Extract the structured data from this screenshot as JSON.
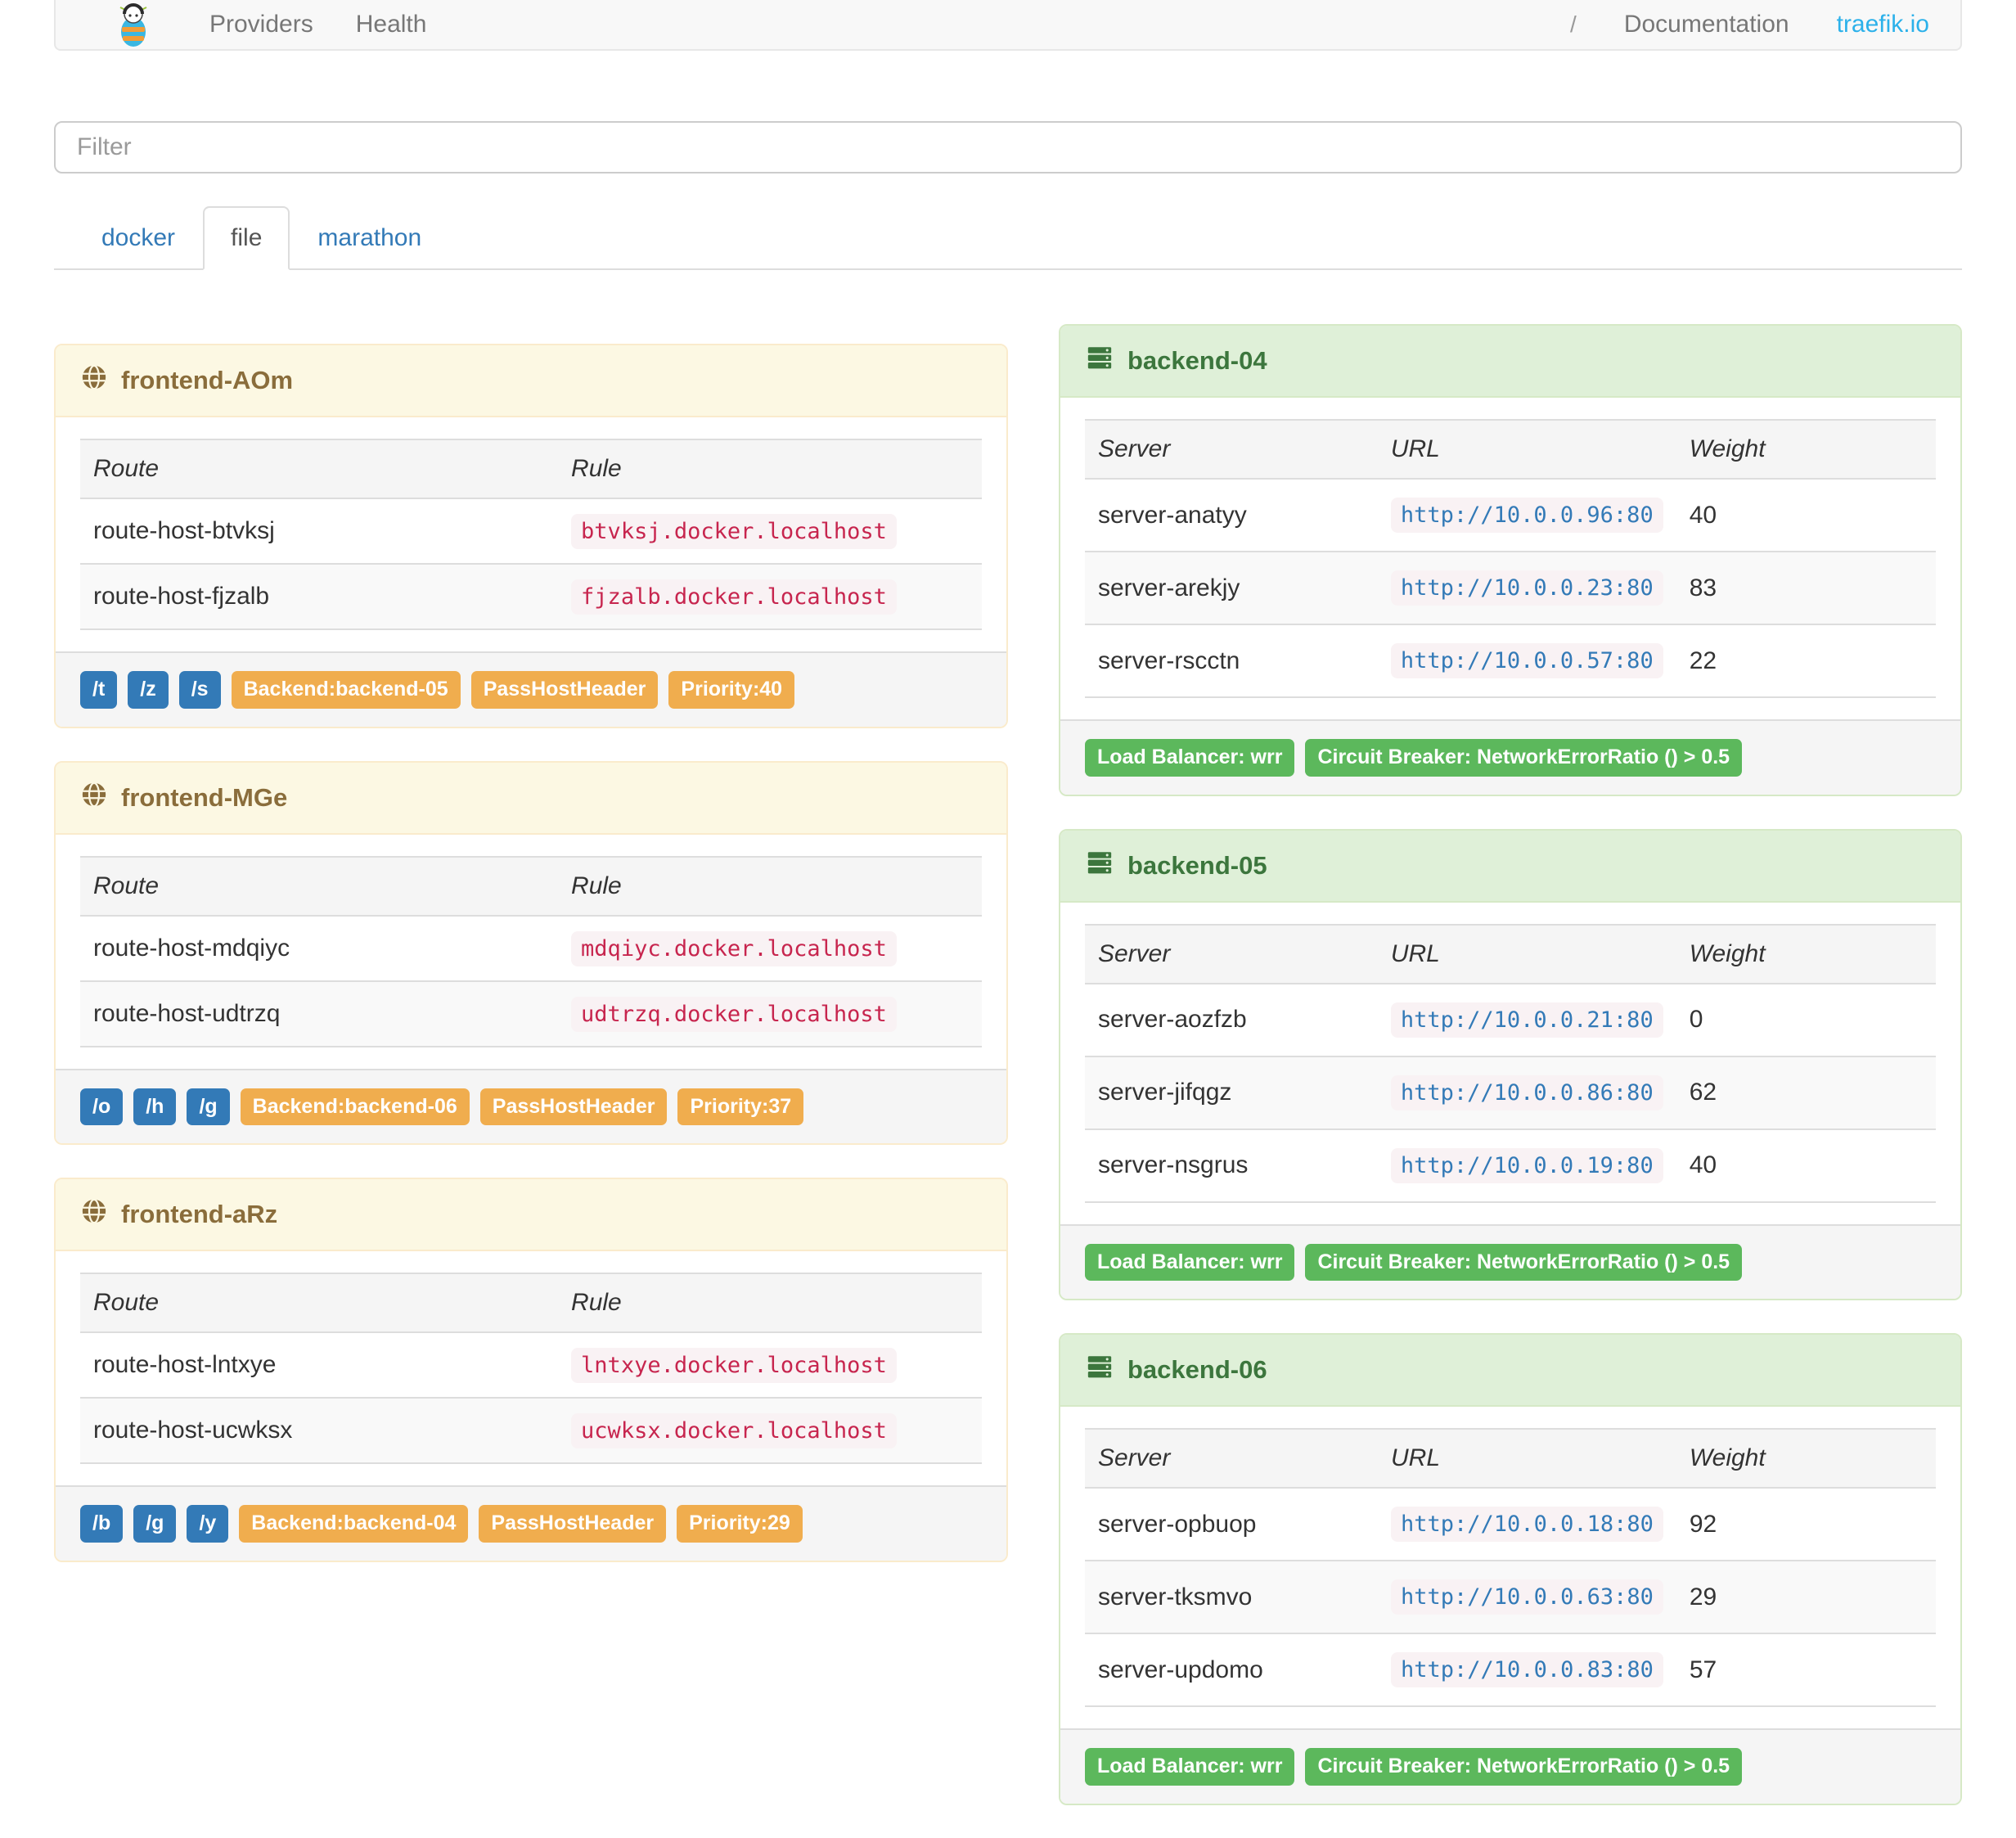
{
  "navbar": {
    "links": [
      {
        "label": "Providers"
      },
      {
        "label": "Health"
      }
    ],
    "right": {
      "divider": "/",
      "documentation": "Documentation",
      "site": "traefik.io"
    }
  },
  "filter": {
    "placeholder": "Filter"
  },
  "tabs": [
    {
      "label": "docker",
      "active": false
    },
    {
      "label": "file",
      "active": true
    },
    {
      "label": "marathon",
      "active": false
    }
  ],
  "frontends": [
    {
      "title": "frontend-AOm",
      "columns": [
        "Route",
        "Rule"
      ],
      "routes": [
        {
          "route": "route-host-btvksj",
          "rule": "btvksj.docker.localhost"
        },
        {
          "route": "route-host-fjzalb",
          "rule": "fjzalb.docker.localhost"
        }
      ],
      "path_badges": [
        "/t",
        "/z",
        "/s"
      ],
      "badges": [
        "Backend:backend-05",
        "PassHostHeader",
        "Priority:40"
      ]
    },
    {
      "title": "frontend-MGe",
      "columns": [
        "Route",
        "Rule"
      ],
      "routes": [
        {
          "route": "route-host-mdqiyc",
          "rule": "mdqiyc.docker.localhost"
        },
        {
          "route": "route-host-udtrzq",
          "rule": "udtrzq.docker.localhost"
        }
      ],
      "path_badges": [
        "/o",
        "/h",
        "/g"
      ],
      "badges": [
        "Backend:backend-06",
        "PassHostHeader",
        "Priority:37"
      ]
    },
    {
      "title": "frontend-aRz",
      "columns": [
        "Route",
        "Rule"
      ],
      "routes": [
        {
          "route": "route-host-lntxye",
          "rule": "lntxye.docker.localhost"
        },
        {
          "route": "route-host-ucwksx",
          "rule": "ucwksx.docker.localhost"
        }
      ],
      "path_badges": [
        "/b",
        "/g",
        "/y"
      ],
      "badges": [
        "Backend:backend-04",
        "PassHostHeader",
        "Priority:29"
      ]
    }
  ],
  "backends": [
    {
      "title": "backend-04",
      "columns": [
        "Server",
        "URL",
        "Weight"
      ],
      "servers": [
        {
          "name": "server-anatyy",
          "url": "http://10.0.0.96:80",
          "weight": "40"
        },
        {
          "name": "server-arekjy",
          "url": "http://10.0.0.23:80",
          "weight": "83"
        },
        {
          "name": "server-rscctn",
          "url": "http://10.0.0.57:80",
          "weight": "22"
        }
      ],
      "badges": [
        "Load Balancer: wrr",
        "Circuit Breaker: NetworkErrorRatio () > 0.5"
      ]
    },
    {
      "title": "backend-05",
      "columns": [
        "Server",
        "URL",
        "Weight"
      ],
      "servers": [
        {
          "name": "server-aozfzb",
          "url": "http://10.0.0.21:80",
          "weight": "0"
        },
        {
          "name": "server-jifqgz",
          "url": "http://10.0.0.86:80",
          "weight": "62"
        },
        {
          "name": "server-nsgrus",
          "url": "http://10.0.0.19:80",
          "weight": "40"
        }
      ],
      "badges": [
        "Load Balancer: wrr",
        "Circuit Breaker: NetworkErrorRatio () > 0.5"
      ]
    },
    {
      "title": "backend-06",
      "columns": [
        "Server",
        "URL",
        "Weight"
      ],
      "servers": [
        {
          "name": "server-opbuop",
          "url": "http://10.0.0.18:80",
          "weight": "92"
        },
        {
          "name": "server-tksmvo",
          "url": "http://10.0.0.63:80",
          "weight": "29"
        },
        {
          "name": "server-updomo",
          "url": "http://10.0.0.83:80",
          "weight": "57"
        }
      ],
      "badges": [
        "Load Balancer: wrr",
        "Circuit Breaker: NetworkErrorRatio () > 0.5"
      ]
    }
  ],
  "colors": {
    "brand_blue": "#2cb1ea",
    "link_blue": "#337ab7",
    "warning_bg": "#fcf8e3",
    "warning_text": "#8a6d3b",
    "success_bg": "#dff0d8",
    "success_text": "#3c763d",
    "label_blue": "#337ab7",
    "label_orange": "#f0ad4e",
    "label_green": "#5cb85c",
    "code_pink_bg": "#f9f2f4",
    "code_crimson": "#c7254e"
  }
}
